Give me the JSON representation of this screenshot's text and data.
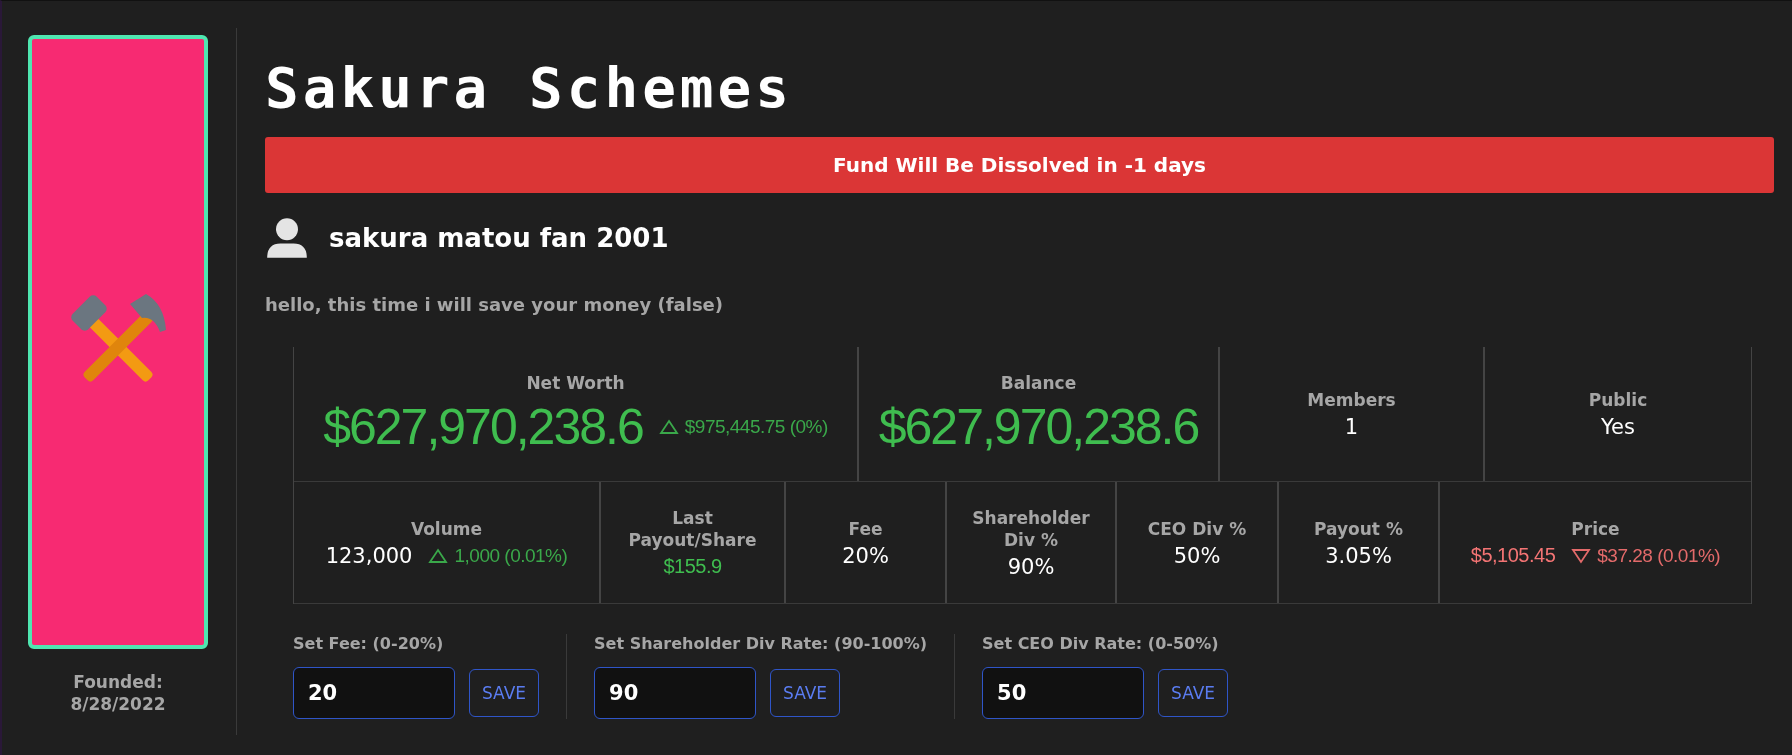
{
  "fund": {
    "name": "Sakura Schemes",
    "banner": "Fund Will Be Dissolved in -1 days",
    "owner": "sakura matou fan 2001",
    "description": "hello, this time i will save your money (false)",
    "founded_label": "Founded:",
    "founded_date": "8/28/2022"
  },
  "stats_top": [
    {
      "label": "Net Worth",
      "value": "$627,970,238.6",
      "kind": "headline",
      "change": {
        "rising": true,
        "text": "$975,445.75 (0%)"
      }
    },
    {
      "label": "Balance",
      "value": "$627,970,238.6",
      "kind": "headline"
    },
    {
      "label": "Members",
      "value": "1",
      "kind": "plain"
    },
    {
      "label": "Public",
      "value": "Yes",
      "kind": "plain"
    }
  ],
  "stats_bottom": [
    {
      "label": "Volume",
      "value": "123,000",
      "kind": "plain",
      "change": {
        "rising": true,
        "text": "1,000 (0.01%)"
      }
    },
    {
      "label": "Last Payout/Share",
      "value": "$155.9",
      "kind": "payout"
    },
    {
      "label": "Fee",
      "value": "20%",
      "kind": "plain"
    },
    {
      "label": "Shareholder Div %",
      "value": "90%",
      "kind": "plain"
    },
    {
      "label": "CEO Div %",
      "value": "50%",
      "kind": "plain"
    },
    {
      "label": "Payout %",
      "value": "3.05%",
      "kind": "plain"
    },
    {
      "label": "Price",
      "value": "$5,105.45",
      "kind": "price",
      "change": {
        "rising": false,
        "text": "$37.28 (0.01%)"
      }
    }
  ],
  "settings": [
    {
      "label": "Set Fee: (0-20%)",
      "value": "20",
      "button": "SAVE"
    },
    {
      "label": "Set Shareholder Div Rate: (90-100%)",
      "value": "90",
      "button": "SAVE"
    },
    {
      "label": "Set CEO Div Rate: (0-50%)",
      "value": "50",
      "button": "SAVE"
    }
  ]
}
